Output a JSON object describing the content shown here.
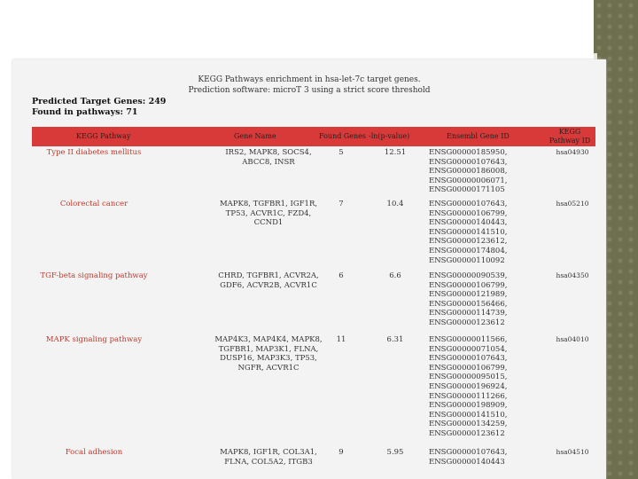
{
  "header": {
    "title_line1": "KEGG Pathways enrichment in hsa-let-7c target genes.",
    "title_line2": "Prediction software: microT 3 using a strict score threshold"
  },
  "meta": {
    "predicted": "Predicted Target Genes: 249",
    "found": "Found in pathways: 71"
  },
  "table": {
    "columns": [
      "KEGG Pathway",
      "Gene Name",
      "Found Genes",
      "-ln(p-value)",
      "Ensembl Gene ID",
      "KEGG Pathway ID"
    ],
    "rows": [
      {
        "pathway": "Type II diabetes mellitus",
        "genes": [
          "IRS2, MAPK8, SOCS4,",
          "ABCC8, INSR"
        ],
        "found": "5",
        "pvalue": "12.51",
        "ensembl": [
          "ENSG00000185950,",
          "ENSG00000107643,",
          "ENSG00000186008,",
          "ENSG00000006071,",
          "ENSG00000171105"
        ],
        "kegg_id": "hsa04930"
      },
      {
        "pathway": "Colorectal cancer",
        "genes": [
          "MAPK8, TGFBR1, IGF1R,",
          "TP53, ACVR1C, FZD4,",
          "CCND1"
        ],
        "found": "7",
        "pvalue": "10.4",
        "ensembl": [
          "ENSG00000107643,",
          "ENSG00000106799,",
          "ENSG00000140443,",
          "ENSG00000141510,",
          "ENSG00000123612,",
          "ENSG00000174804,",
          "ENSG00000110092"
        ],
        "kegg_id": "hsa05210"
      },
      {
        "pathway": "TGF-beta signaling pathway",
        "genes": [
          "CHRD, TGFBR1, ACVR2A,",
          "GDF6, ACVR2B, ACVR1C"
        ],
        "found": "6",
        "pvalue": "6.6",
        "ensembl": [
          "ENSG00000090539,",
          "ENSG00000106799,",
          "ENSG00000121989,",
          "ENSG00000156466,",
          "ENSG00000114739,",
          "ENSG00000123612"
        ],
        "kegg_id": "hsa04350"
      },
      {
        "pathway": "MAPK signaling pathway",
        "genes": [
          "MAP4K3, MAP4K4, MAPK8,",
          "TGFBR1, MAP3K1, FLNA,",
          "DUSP16, MAP3K3, TP53,",
          "NGFR, ACVR1C"
        ],
        "found": "11",
        "pvalue": "6.31",
        "ensembl": [
          "ENSG00000011566,",
          "ENSG00000071054,",
          "ENSG00000107643,",
          "ENSG00000106799,",
          "ENSG00000095015,",
          "ENSG00000196924,",
          "ENSG00000111266,",
          "ENSG00000198909,",
          "ENSG00000141510,",
          "ENSG00000134259,",
          "ENSG00000123612"
        ],
        "kegg_id": "hsa04010"
      },
      {
        "pathway": "Focal adhesion",
        "genes": [
          "MAPK8, IGF1R, COL3A1,",
          "FLNA, COL5A2, ITGB3"
        ],
        "found": "9",
        "pvalue": "5.95",
        "ensembl": [
          "ENSG00000107643,",
          "ENSG00000140443"
        ],
        "kegg_id": "hsa04510"
      }
    ]
  },
  "colors": {
    "header_bg": "#d83a3a",
    "pathway_text": "#c0392b",
    "side_bar": "#6e6f4f"
  }
}
